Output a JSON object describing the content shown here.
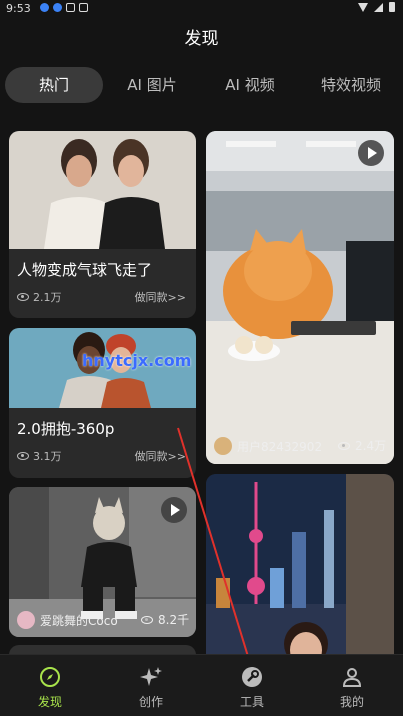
{
  "status_bar": {
    "time": "9:53"
  },
  "page": {
    "title": "发现"
  },
  "tabs": [
    {
      "label": "热门",
      "active": true
    },
    {
      "label": "AI 图片",
      "active": false
    },
    {
      "label": "AI 视频",
      "active": false
    },
    {
      "label": "特效视频",
      "active": false
    }
  ],
  "cards": {
    "balloon": {
      "title": "人物变成气球飞走了",
      "views": "2.1万",
      "cta": "做同款>>"
    },
    "hug": {
      "title": "2.0拥抱-360p",
      "views": "3.1万",
      "cta": "做同款>>"
    },
    "dance": {
      "user": "爱跳舞的Coco",
      "views": "8.2千"
    },
    "cat": {
      "user": "用户82432902",
      "views": "2.4万"
    }
  },
  "watermark": "hnytcjx.com",
  "bottom_nav": [
    {
      "label": "发现",
      "icon": "compass-icon",
      "active": true
    },
    {
      "label": "创作",
      "icon": "sparkle-icon",
      "active": false
    },
    {
      "label": "工具",
      "icon": "tools-icon",
      "active": false
    },
    {
      "label": "我的",
      "icon": "person-icon",
      "active": false
    }
  ],
  "colors": {
    "accent": "#a8e34b",
    "background": "#141414",
    "card": "#2a2a2a",
    "annotation_arrow": "#e0312b"
  }
}
